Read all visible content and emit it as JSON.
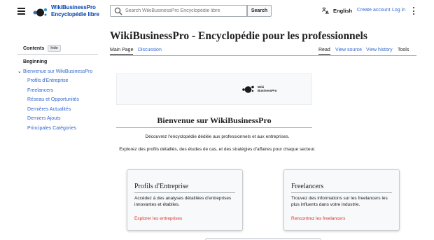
{
  "header": {
    "menu_icon": "hamburger-menu-icon",
    "logo_line1": "WikiBusinessPro",
    "logo_line2": "Encyclopédie libre",
    "search_placeholder": "Search WikiBusinessPro Encyclopédie libre",
    "search_button": "Search",
    "language": "English",
    "create_account": "Create account",
    "log_in": "Log in",
    "more_icon": "vertical-ellipsis-icon"
  },
  "toc": {
    "title": "Contents",
    "hide": "hide",
    "beginning": "Beginning",
    "section": "Bienvenue sur WikiBusinessPro",
    "items": [
      "Profils d'Entreprise",
      "Freelancers",
      "Réseau et Opportunités",
      "Dernières Actualités",
      "Derniers Ajouts",
      "Principales Catégories"
    ]
  },
  "page": {
    "title": "WikiBusinessPro - Encyclopédie pour les professionnels",
    "tabs_left": [
      "Main Page",
      "Discussion"
    ],
    "tabs_right": [
      "Read",
      "View source",
      "View history",
      "Tools"
    ]
  },
  "banner": {
    "logo_line1": "Wiki",
    "logo_line2": "BusinessPro"
  },
  "content": {
    "welcome": "Bienvenue sur WikiBusinessPro",
    "intro1": "Découvrez l'encyclopédie dédiée aux professionnels et aux entreprises.",
    "intro2": "Explorez des profils détaillés, des études de cas, et des stratégies d'affaires pour chaque secteur.",
    "cards": [
      {
        "title": "Profils d'Entreprise",
        "desc": "Accédez à des analyses détaillées d'entreprises innovantes et établies.",
        "link": "Explorer les entreprises"
      },
      {
        "title": "Freelancers",
        "desc": "Trouvez des informations sur les freelancers les plus influents dans votre industrie.",
        "link": "Rencontrez les freelancers"
      }
    ]
  },
  "colors": {
    "link": "#3366cc",
    "card_link": "#dd3333",
    "text": "#202122",
    "border": "#a2a9b1"
  }
}
